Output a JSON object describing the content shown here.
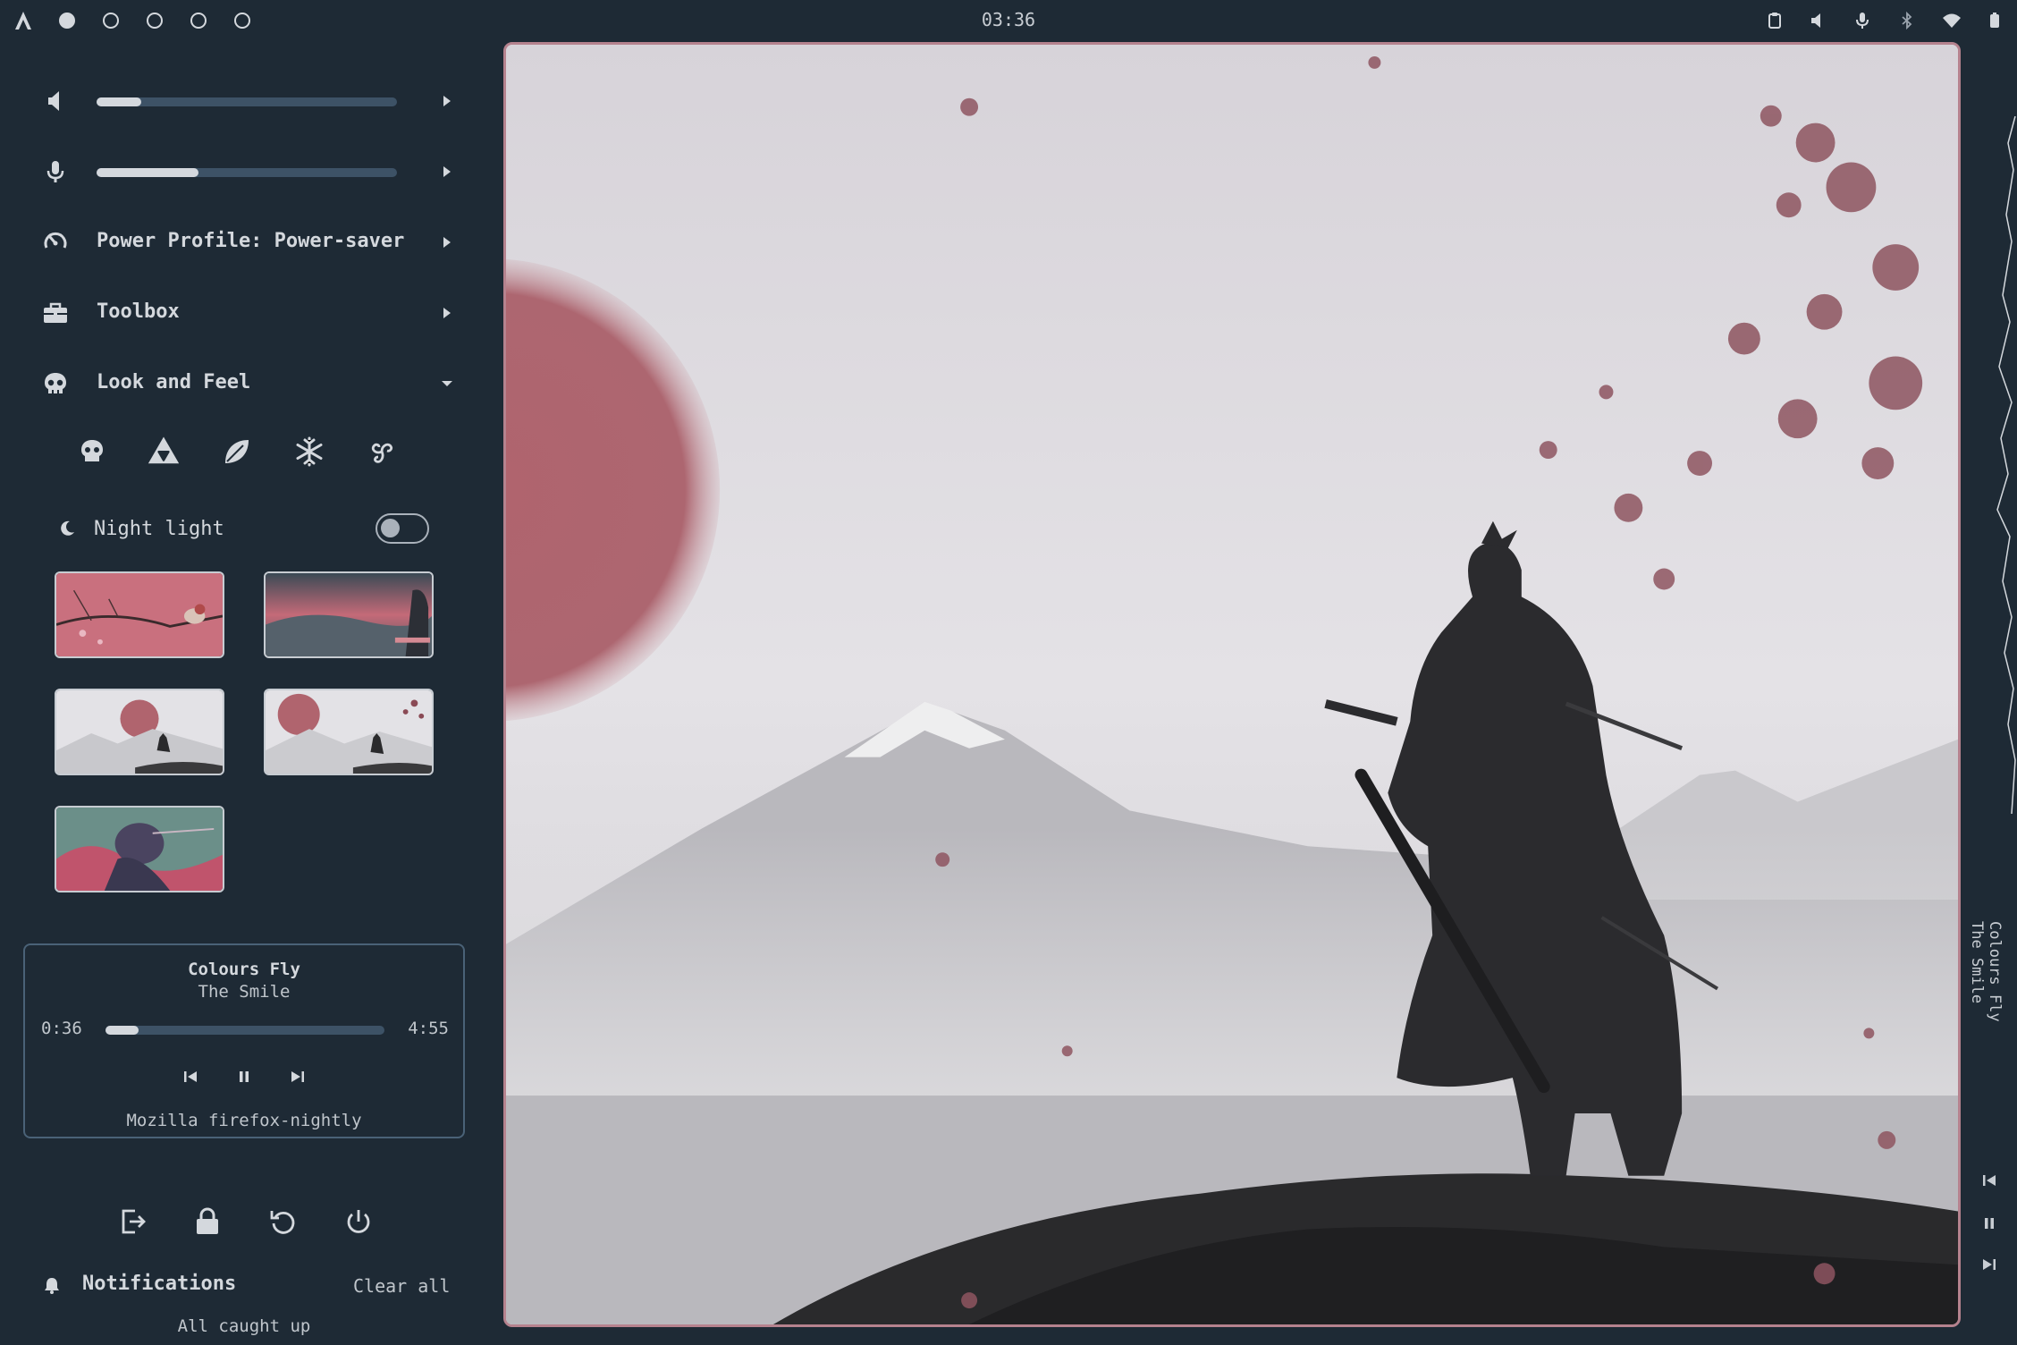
{
  "topbar": {
    "clock": "03:36",
    "workspaces": [
      {
        "id": 1,
        "active": true
      },
      {
        "id": 2,
        "active": false
      },
      {
        "id": 3,
        "active": false
      },
      {
        "id": 4,
        "active": false
      },
      {
        "id": 5,
        "active": false
      }
    ],
    "tray_icons": [
      "clipboard-icon",
      "volume-icon",
      "microphone-icon",
      "bluetooth-icon",
      "wifi-icon",
      "battery-icon"
    ]
  },
  "quick_settings": {
    "volume": {
      "level": 0.15,
      "icon": "speaker-icon"
    },
    "microphone": {
      "level": 0.34,
      "icon": "microphone-icon"
    },
    "power_profile": {
      "label": "Power Profile: Power-saver",
      "icon": "gauge-icon"
    },
    "toolbox": {
      "label": "Toolbox",
      "icon": "toolbox-icon"
    },
    "look_and_feel": {
      "label": "Look and Feel",
      "icon": "skull-icon",
      "expanded": true
    },
    "theme_icons": [
      "skull-icon",
      "triforce-icon",
      "leaf-icon",
      "snowflake-icon",
      "triskelion-icon"
    ],
    "night_light": {
      "label": "Night light",
      "enabled": false
    }
  },
  "wallpapers": [
    {
      "name": "bird-on-branch"
    },
    {
      "name": "pink-clouds-figure"
    },
    {
      "name": "samurai-red-sun"
    },
    {
      "name": "samurai-red-sun-alt"
    },
    {
      "name": "skull-warrior"
    }
  ],
  "media": {
    "title": "Colours Fly",
    "artist": "The Smile",
    "position": "0:36",
    "duration": "4:55",
    "progress": 0.12,
    "source": "Mozilla firefox-nightly"
  },
  "session_buttons": [
    "logout-icon",
    "lock-icon",
    "restart-icon",
    "power-icon"
  ],
  "notifications": {
    "title": "Notifications",
    "clear_label": "Clear all",
    "empty_text": "All caught up"
  },
  "side_panel": {
    "track_title": "Colours Fly",
    "track_artist": "The Smile"
  },
  "colors": {
    "background": "#1e2a35",
    "foreground": "#d4d8dd",
    "track": "#3d5266",
    "accent_border": "#b5828e",
    "sun": "#b0646e"
  }
}
